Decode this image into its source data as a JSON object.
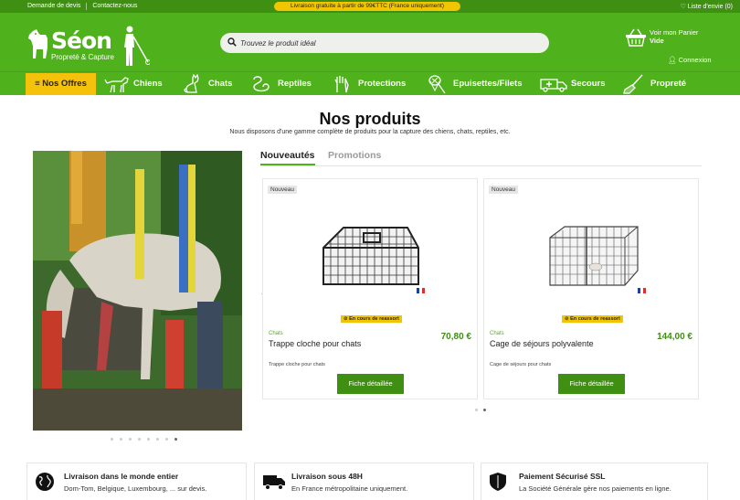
{
  "topbar": {
    "link_quote": "Demande de devis",
    "link_contact": "Contactez-nous",
    "promo": "Livraison gratuite à partir de 99€TTC (France uniquement)",
    "wishlist": "♡ Liste d'envie (0)"
  },
  "header": {
    "brand": "Séon",
    "tagline": "Propreté & Capture",
    "search_placeholder": "Trouvez le produit idéal",
    "cart_label": "Voir mon Panier",
    "cart_status": "Vide",
    "login": "Connexion"
  },
  "nav": {
    "offers": "≡ Nos Offres",
    "items": [
      {
        "label": "Chiens",
        "icon": "dog-icon"
      },
      {
        "label": "Chats",
        "icon": "cat-icon"
      },
      {
        "label": "Reptiles",
        "icon": "snake-icon"
      },
      {
        "label": "Protections",
        "icon": "glove-icon"
      },
      {
        "label": "Epuisettes/Filets",
        "icon": "net-icon"
      },
      {
        "label": "Secours",
        "icon": "ambulance-icon"
      },
      {
        "label": "Propreté",
        "icon": "broom-icon"
      }
    ]
  },
  "main": {
    "title": "Nos produits",
    "subtitle": "Nous disposons d'une gamme complète de produits pour la capture des chiens, chats, reptiles, etc.",
    "tabs": [
      {
        "label": "Nouveautés",
        "active": true
      },
      {
        "label": "Promotions",
        "active": false
      }
    ],
    "products": [
      {
        "badge": "Nouveau",
        "stock": "⊘ En cours de reassort",
        "category": "Chats",
        "name": "Trappe cloche pour chats",
        "price": "70,80 €",
        "description": "Trappe cloche pour chats",
        "button": "Fiche détaillée"
      },
      {
        "badge": "Nouveau",
        "stock": "⊘ En cours de reassort",
        "category": "Chats",
        "name": "Cage de séjours polyvalente",
        "price": "144,00 €",
        "description": "Cage de séjours pour chats",
        "button": "Fiche détaillée"
      }
    ],
    "prev_arrow": "‹",
    "next_arrow": "›"
  },
  "features": [
    {
      "title": "Livraison dans le monde entier",
      "text": "Dom-Tom, Belgique, Luxembourg, ... sur devis.",
      "icon": "globe-icon"
    },
    {
      "title": "Livraison sous 48H",
      "text": "En France métropolitaine uniquement.",
      "icon": "truck-icon"
    },
    {
      "title": "Paiement Sécurisé SSL",
      "text": "La Société Générale gère nos paiements en ligne.",
      "icon": "shield-icon"
    }
  ],
  "colors": {
    "brand_green": "#4fb11b",
    "dark_green": "#3f8f12",
    "accent_yellow": "#f4c20a"
  }
}
